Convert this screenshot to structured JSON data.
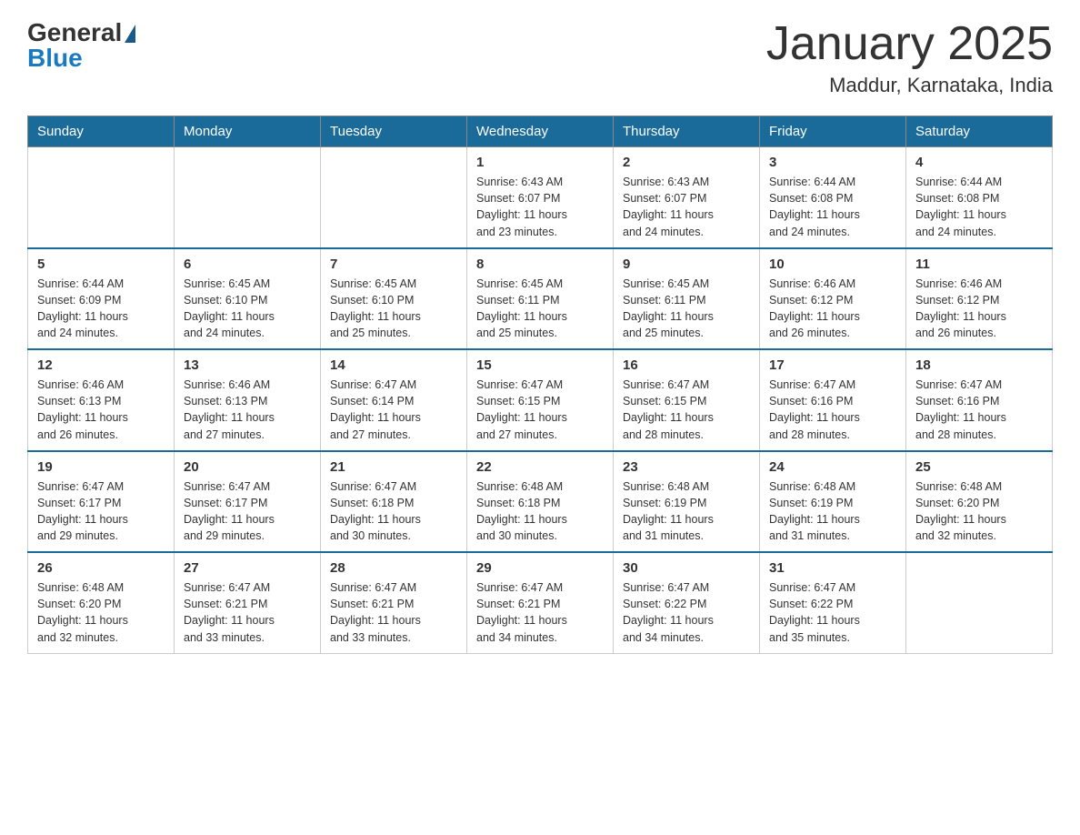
{
  "header": {
    "title": "January 2025",
    "subtitle": "Maddur, Karnataka, India"
  },
  "logo": {
    "general": "General",
    "triangle": "",
    "blue": "Blue"
  },
  "days": [
    "Sunday",
    "Monday",
    "Tuesday",
    "Wednesday",
    "Thursday",
    "Friday",
    "Saturday"
  ],
  "weeks": [
    [
      {
        "day": "",
        "info": ""
      },
      {
        "day": "",
        "info": ""
      },
      {
        "day": "",
        "info": ""
      },
      {
        "day": "1",
        "info": "Sunrise: 6:43 AM\nSunset: 6:07 PM\nDaylight: 11 hours\nand 23 minutes."
      },
      {
        "day": "2",
        "info": "Sunrise: 6:43 AM\nSunset: 6:07 PM\nDaylight: 11 hours\nand 24 minutes."
      },
      {
        "day": "3",
        "info": "Sunrise: 6:44 AM\nSunset: 6:08 PM\nDaylight: 11 hours\nand 24 minutes."
      },
      {
        "day": "4",
        "info": "Sunrise: 6:44 AM\nSunset: 6:08 PM\nDaylight: 11 hours\nand 24 minutes."
      }
    ],
    [
      {
        "day": "5",
        "info": "Sunrise: 6:44 AM\nSunset: 6:09 PM\nDaylight: 11 hours\nand 24 minutes."
      },
      {
        "day": "6",
        "info": "Sunrise: 6:45 AM\nSunset: 6:10 PM\nDaylight: 11 hours\nand 24 minutes."
      },
      {
        "day": "7",
        "info": "Sunrise: 6:45 AM\nSunset: 6:10 PM\nDaylight: 11 hours\nand 25 minutes."
      },
      {
        "day": "8",
        "info": "Sunrise: 6:45 AM\nSunset: 6:11 PM\nDaylight: 11 hours\nand 25 minutes."
      },
      {
        "day": "9",
        "info": "Sunrise: 6:45 AM\nSunset: 6:11 PM\nDaylight: 11 hours\nand 25 minutes."
      },
      {
        "day": "10",
        "info": "Sunrise: 6:46 AM\nSunset: 6:12 PM\nDaylight: 11 hours\nand 26 minutes."
      },
      {
        "day": "11",
        "info": "Sunrise: 6:46 AM\nSunset: 6:12 PM\nDaylight: 11 hours\nand 26 minutes."
      }
    ],
    [
      {
        "day": "12",
        "info": "Sunrise: 6:46 AM\nSunset: 6:13 PM\nDaylight: 11 hours\nand 26 minutes."
      },
      {
        "day": "13",
        "info": "Sunrise: 6:46 AM\nSunset: 6:13 PM\nDaylight: 11 hours\nand 27 minutes."
      },
      {
        "day": "14",
        "info": "Sunrise: 6:47 AM\nSunset: 6:14 PM\nDaylight: 11 hours\nand 27 minutes."
      },
      {
        "day": "15",
        "info": "Sunrise: 6:47 AM\nSunset: 6:15 PM\nDaylight: 11 hours\nand 27 minutes."
      },
      {
        "day": "16",
        "info": "Sunrise: 6:47 AM\nSunset: 6:15 PM\nDaylight: 11 hours\nand 28 minutes."
      },
      {
        "day": "17",
        "info": "Sunrise: 6:47 AM\nSunset: 6:16 PM\nDaylight: 11 hours\nand 28 minutes."
      },
      {
        "day": "18",
        "info": "Sunrise: 6:47 AM\nSunset: 6:16 PM\nDaylight: 11 hours\nand 28 minutes."
      }
    ],
    [
      {
        "day": "19",
        "info": "Sunrise: 6:47 AM\nSunset: 6:17 PM\nDaylight: 11 hours\nand 29 minutes."
      },
      {
        "day": "20",
        "info": "Sunrise: 6:47 AM\nSunset: 6:17 PM\nDaylight: 11 hours\nand 29 minutes."
      },
      {
        "day": "21",
        "info": "Sunrise: 6:47 AM\nSunset: 6:18 PM\nDaylight: 11 hours\nand 30 minutes."
      },
      {
        "day": "22",
        "info": "Sunrise: 6:48 AM\nSunset: 6:18 PM\nDaylight: 11 hours\nand 30 minutes."
      },
      {
        "day": "23",
        "info": "Sunrise: 6:48 AM\nSunset: 6:19 PM\nDaylight: 11 hours\nand 31 minutes."
      },
      {
        "day": "24",
        "info": "Sunrise: 6:48 AM\nSunset: 6:19 PM\nDaylight: 11 hours\nand 31 minutes."
      },
      {
        "day": "25",
        "info": "Sunrise: 6:48 AM\nSunset: 6:20 PM\nDaylight: 11 hours\nand 32 minutes."
      }
    ],
    [
      {
        "day": "26",
        "info": "Sunrise: 6:48 AM\nSunset: 6:20 PM\nDaylight: 11 hours\nand 32 minutes."
      },
      {
        "day": "27",
        "info": "Sunrise: 6:47 AM\nSunset: 6:21 PM\nDaylight: 11 hours\nand 33 minutes."
      },
      {
        "day": "28",
        "info": "Sunrise: 6:47 AM\nSunset: 6:21 PM\nDaylight: 11 hours\nand 33 minutes."
      },
      {
        "day": "29",
        "info": "Sunrise: 6:47 AM\nSunset: 6:21 PM\nDaylight: 11 hours\nand 34 minutes."
      },
      {
        "day": "30",
        "info": "Sunrise: 6:47 AM\nSunset: 6:22 PM\nDaylight: 11 hours\nand 34 minutes."
      },
      {
        "day": "31",
        "info": "Sunrise: 6:47 AM\nSunset: 6:22 PM\nDaylight: 11 hours\nand 35 minutes."
      },
      {
        "day": "",
        "info": ""
      }
    ]
  ]
}
